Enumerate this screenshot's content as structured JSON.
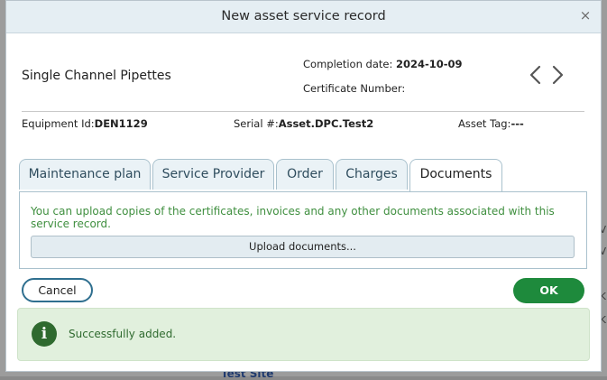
{
  "dialog": {
    "title": "New asset service record",
    "close_symbol": "×"
  },
  "asset": {
    "name": "Single Channel Pipettes",
    "completion_label": "Completion date:",
    "completion_value": "2024-10-09",
    "certificate_label": "Certificate Number:",
    "certificate_value": "",
    "equipment_label": "Equipment Id:",
    "equipment_value": "DEN1129",
    "serial_label": "Serial #:",
    "serial_value": "Asset.DPC.Test2",
    "tag_label": "Asset Tag:",
    "tag_value": "---"
  },
  "tabs": [
    {
      "label": "Maintenance plan"
    },
    {
      "label": "Service Provider"
    },
    {
      "label": "Order"
    },
    {
      "label": "Charges"
    },
    {
      "label": "Documents",
      "active": true
    }
  ],
  "documents": {
    "info": "You can upload copies of the certificates, invoices and any other documents associated with this service record.",
    "upload_label": "Upload documents..."
  },
  "footer": {
    "cancel_label": "Cancel",
    "ok_label": "OK"
  },
  "toast": {
    "icon_glyph": "i",
    "message": "Successfully added."
  },
  "background": {
    "edge_letters": [
      "V",
      "V",
      "K",
      "K"
    ],
    "bottom_text": "Test Site"
  },
  "colors": {
    "accent": "#2f6f8f",
    "ok_green": "#1e8a3c",
    "info_text": "#3f8f3f",
    "toast_bg": "#e1f0dd"
  },
  "icons": {
    "close": "close-icon",
    "prev": "chevron-left-icon",
    "next": "chevron-right-icon",
    "info": "info-icon"
  }
}
